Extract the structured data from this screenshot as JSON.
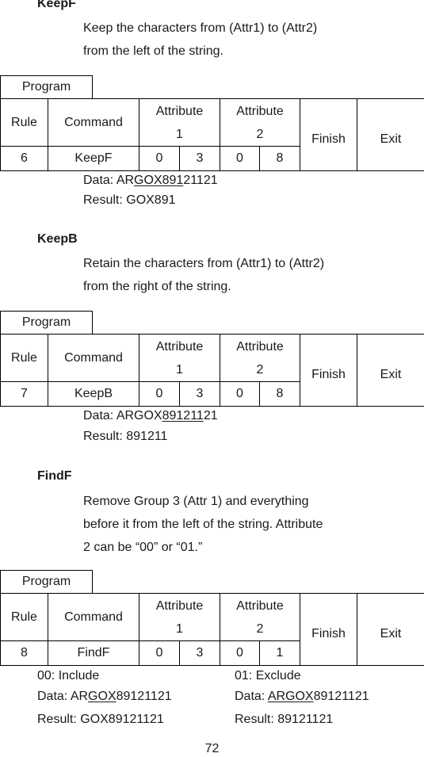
{
  "sections": [
    {
      "heading": "KeepF",
      "desc_line1": "Keep the characters from (Attr1) to (Attr2)",
      "desc_line2": "from the left of the string.",
      "program_label": "Program",
      "table": {
        "headers": {
          "rule": "Rule",
          "command": "Command",
          "attr1_top": "Attribute",
          "attr1_bot": "1",
          "attr2_top": "Attribute",
          "attr2_bot": "2",
          "finish": "Finish",
          "exit": "Exit"
        },
        "row": {
          "rule": "6",
          "command": "KeepF",
          "a1a": "0",
          "a1b": "3",
          "a2a": "0",
          "a2b": "8"
        }
      },
      "data": {
        "label": "Data: ",
        "pre": "AR",
        "underlined": "GOX891",
        "post": "21121"
      },
      "result": "Result: GOX891"
    },
    {
      "heading": "KeepB",
      "desc_line1": "Retain the characters from (Attr1) to (Attr2)",
      "desc_line2": "from the right of the string.",
      "program_label": "Program",
      "table": {
        "headers": {
          "rule": "Rule",
          "command": "Command",
          "attr1_top": "Attribute",
          "attr1_bot": "1",
          "attr2_top": "Attribute",
          "attr2_bot": "2",
          "finish": "Finish",
          "exit": "Exit"
        },
        "row": {
          "rule": "7",
          "command": "KeepB",
          "a1a": "0",
          "a1b": "3",
          "a2a": "0",
          "a2b": "8"
        }
      },
      "data": {
        "label": "Data: ",
        "pre": "ARGOX",
        "underlined": "891211",
        "post": "21"
      },
      "result": "Result: 891211"
    },
    {
      "heading": "FindF",
      "desc_line1": "Remove Group 3 (Attr 1) and everything",
      "desc_line2": "before it from the left of the string. Attribute",
      "desc_line3": "2 can be “00” or “01.”",
      "program_label": "Program",
      "table": {
        "headers": {
          "rule": "Rule",
          "command": "Command",
          "attr1_top": "Attribute",
          "attr1_bot": "1",
          "attr2_top": "Attribute",
          "attr2_bot": "2",
          "finish": "Finish",
          "exit": "Exit"
        },
        "row": {
          "rule": "8",
          "command": "FindF",
          "a1a": "0",
          "a1b": "3",
          "a2a": "0",
          "a2b": "1"
        }
      },
      "include": {
        "title": "00: Include",
        "data_label": "Data: ",
        "data_pre": "AR",
        "data_underlined": "GOX",
        "data_post": "89121121",
        "result": "Result: GOX89121121"
      },
      "exclude": {
        "title": "01: Exclude",
        "data_label": "Data: ",
        "data_pre": "",
        "data_underlined": "ARGOX",
        "data_post": "89121121",
        "result": "Result: 89121121"
      }
    }
  ],
  "page_number": "72"
}
